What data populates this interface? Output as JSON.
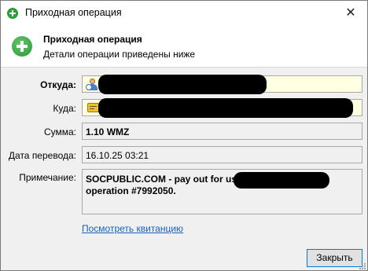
{
  "window": {
    "title": "Приходная операция",
    "close_glyph": "✕",
    "icon": "green-plus-circle-icon"
  },
  "header": {
    "title": "Приходная операция",
    "subtitle": "Детали операции приведены ниже",
    "icon": "green-plus-circle-icon"
  },
  "fields": {
    "from_label": "Откуда:",
    "from_value": "",
    "to_label": "Куда:",
    "to_value": "",
    "amount_label": "Сумма:",
    "amount_value": "1.10 WMZ",
    "date_label": "Дата перевода:",
    "date_value": "16.10.25 03:21",
    "note_label": "Примечание:",
    "note_line1": "SOCPUBLIC.COM - pay out for user",
    "note_line2": "operation #7992050."
  },
  "links": {
    "view_receipt": "Посмотреть квитанцию"
  },
  "buttons": {
    "close": "Закрыть"
  },
  "colors": {
    "accent": "#0078d7",
    "link": "#1a5fbf",
    "field_highlight": "#ffffe1",
    "icon_green": "#2e9e3a"
  }
}
